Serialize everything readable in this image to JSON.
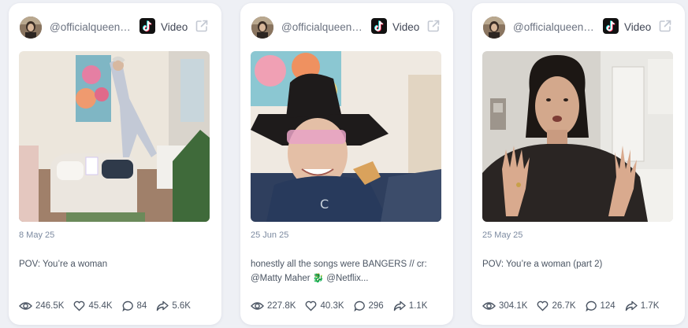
{
  "cards": [
    {
      "username": "@officialqueenofbabu",
      "platform": "tiktok-icon",
      "type_label": "Video",
      "date": "8 May 25",
      "caption": "POV: You’re a woman",
      "stats": {
        "views": "246.5K",
        "likes": "45.4K",
        "comments": "84",
        "shares": "5.6K"
      }
    },
    {
      "username": "@officialqueenofbabu",
      "platform": "tiktok-icon",
      "type_label": "Video",
      "date": "25 Jun 25",
      "caption": "honestly all the songs were BANGERS // cr: @Matty Maher 🐉 @Netflix...",
      "stats": {
        "views": "227.8K",
        "likes": "40.3K",
        "comments": "296",
        "shares": "1.1K"
      }
    },
    {
      "username": "@officialqueenofbabu",
      "platform": "tiktok-icon",
      "type_label": "Video",
      "date": "25 May 25",
      "caption": "POV: You’re a woman (part 2)",
      "stats": {
        "views": "304.1K",
        "likes": "26.7K",
        "comments": "124",
        "shares": "1.7K"
      }
    }
  ],
  "colors": {
    "background": "#eef0f5",
    "card": "#ffffff",
    "muted_text": "#6b7280",
    "date_text": "#7c8aa0",
    "tiktok_cyan": "#25f4ee",
    "tiktok_red": "#fe2c55"
  }
}
